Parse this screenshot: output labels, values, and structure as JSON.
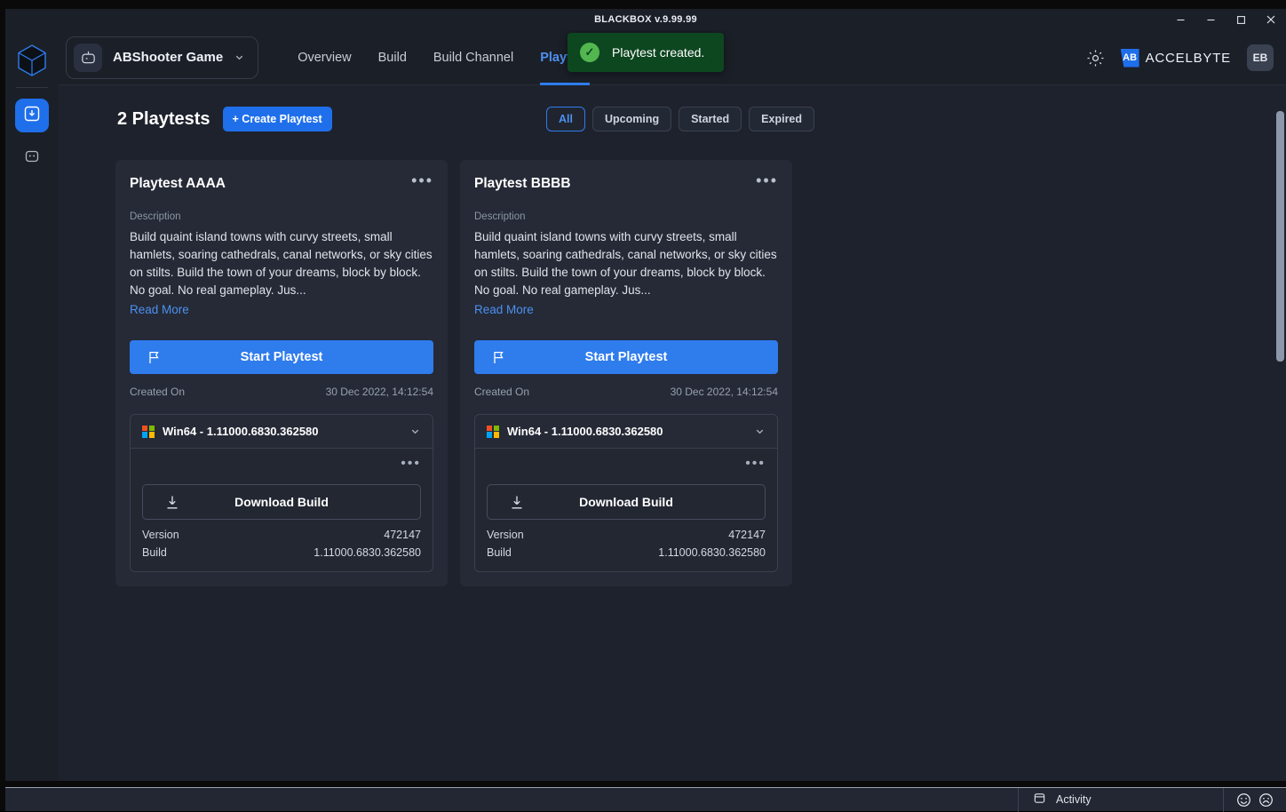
{
  "titlebar": {
    "title": "BLACKBOX v.9.99.99",
    "minimize_label": "minimize",
    "minimize2_label": "minimize",
    "maximize_label": "maximize",
    "close_label": "close"
  },
  "toast": {
    "message": "Playtest created.",
    "icon": "check-circle-icon",
    "bg": "#0d4720",
    "icon_color": "#52b74e"
  },
  "header": {
    "game_name": "ABShooter Game",
    "game_icon": "robot-icon",
    "chevron_icon": "chevron-down-icon",
    "gear_icon": "gear-icon",
    "brand_mark": "AB",
    "brand_text": "ACCELBYTE",
    "avatar_initials": "EB",
    "nav": [
      {
        "label": "Overview",
        "active": false
      },
      {
        "label": "Build",
        "active": false
      },
      {
        "label": "Build Channel",
        "active": false
      },
      {
        "label": "Playtest",
        "active": true
      }
    ]
  },
  "sidebar": {
    "logo_icon": "cube-logo-icon",
    "items": [
      {
        "name": "playtest-rail-item",
        "icon": "import-build-icon",
        "active": true
      },
      {
        "name": "activity-rail-item",
        "icon": "rounded-square-icon",
        "active": false
      }
    ]
  },
  "toolbar": {
    "count_label": "2 Playtests",
    "create_label": "+ Create Playtest",
    "accent": "#1f6feb"
  },
  "filters": [
    {
      "label": "All",
      "active": true
    },
    {
      "label": "Upcoming",
      "active": false
    },
    {
      "label": "Started",
      "active": false
    },
    {
      "label": "Expired",
      "active": false
    }
  ],
  "cards": [
    {
      "title": "Playtest AAAA",
      "menu_icon": "more-options-icon",
      "description_label": "Description",
      "description": "Build quaint island towns with curvy streets, small hamlets, soaring cathedrals, canal networks, or sky cities on stilts. Build the town of your dreams, block by block. No goal. No real gameplay. Jus...",
      "read_more_label": "Read More",
      "start_label": "Start Playtest",
      "start_icon": "flag-icon",
      "created_label": "Created On",
      "created_value": "30 Dec 2022, 14:12:54",
      "build": {
        "platform_icon": "windows-icon",
        "header": "Win64 - 1.11000.6830.362580",
        "chevron_icon": "chevron-down-icon",
        "menu_icon": "more-options-icon",
        "download_label": "Download Build",
        "download_icon": "download-icon",
        "version_label": "Version",
        "version_value": "472147",
        "build_label": "Build",
        "build_value": "1.11000.6830.362580"
      }
    },
    {
      "title": "Playtest BBBB",
      "menu_icon": "more-options-icon",
      "description_label": "Description",
      "description": "Build quaint island towns with curvy streets, small hamlets, soaring cathedrals, canal networks, or sky cities on stilts. Build the town of your dreams, block by block. No goal. No real gameplay. Jus...",
      "read_more_label": "Read More",
      "start_label": "Start Playtest",
      "start_icon": "flag-icon",
      "created_label": "Created On",
      "created_value": "30 Dec 2022, 14:12:54",
      "build": {
        "platform_icon": "windows-icon",
        "header": "Win64 - 1.11000.6830.362580",
        "chevron_icon": "chevron-down-icon",
        "menu_icon": "more-options-icon",
        "download_label": "Download Build",
        "download_icon": "download-icon",
        "version_label": "Version",
        "version_value": "472147",
        "build_label": "Build",
        "build_value": "1.11000.6830.362580"
      }
    }
  ],
  "statusbar": {
    "activity_label": "Activity",
    "activity_icon": "panel-icon",
    "happy_icon": "happy-face-icon",
    "sad_icon": "sad-face-icon"
  }
}
